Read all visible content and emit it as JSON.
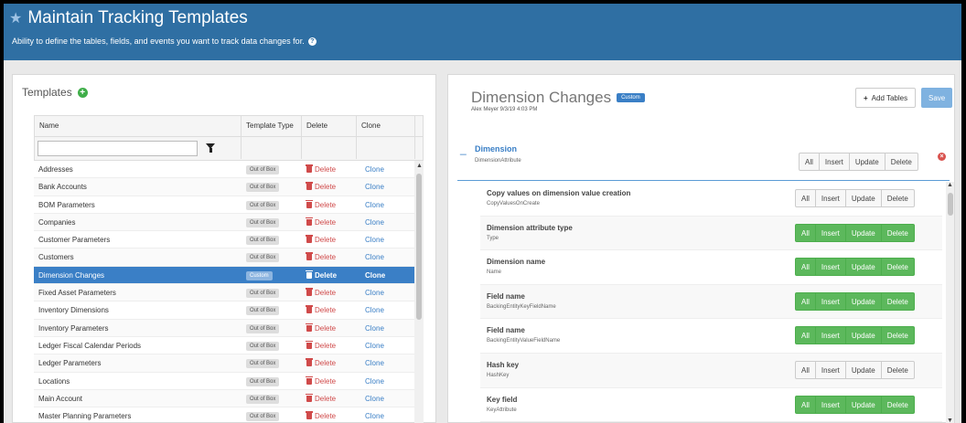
{
  "header": {
    "title": "Maintain Tracking Templates",
    "subtitle": "Ability to define the tables, fields, and events you want to track data changes for."
  },
  "templates_panel": {
    "heading": "Templates",
    "columns": [
      "Name",
      "Template Type",
      "Delete",
      "Clone"
    ],
    "filter_value": "",
    "rows": [
      {
        "name": "Addresses",
        "type": "Out of Box",
        "delete": "Delete",
        "clone": "Clone",
        "selected": false
      },
      {
        "name": "Bank Accounts",
        "type": "Out of Box",
        "delete": "Delete",
        "clone": "Clone",
        "selected": false
      },
      {
        "name": "BOM Parameters",
        "type": "Out of Box",
        "delete": "Delete",
        "clone": "Clone",
        "selected": false
      },
      {
        "name": "Companies",
        "type": "Out of Box",
        "delete": "Delete",
        "clone": "Clone",
        "selected": false
      },
      {
        "name": "Customer Parameters",
        "type": "Out of Box",
        "delete": "Delete",
        "clone": "Clone",
        "selected": false
      },
      {
        "name": "Customers",
        "type": "Out of Box",
        "delete": "Delete",
        "clone": "Clone",
        "selected": false
      },
      {
        "name": "Dimension Changes",
        "type": "Custom",
        "delete": "Delete",
        "clone": "Clone",
        "selected": true
      },
      {
        "name": "Fixed Asset Parameters",
        "type": "Out of Box",
        "delete": "Delete",
        "clone": "Clone",
        "selected": false
      },
      {
        "name": "Inventory Dimensions",
        "type": "Out of Box",
        "delete": "Delete",
        "clone": "Clone",
        "selected": false
      },
      {
        "name": "Inventory Parameters",
        "type": "Out of Box",
        "delete": "Delete",
        "clone": "Clone",
        "selected": false
      },
      {
        "name": "Ledger Fiscal Calendar Periods",
        "type": "Out of Box",
        "delete": "Delete",
        "clone": "Clone",
        "selected": false
      },
      {
        "name": "Ledger Parameters",
        "type": "Out of Box",
        "delete": "Delete",
        "clone": "Clone",
        "selected": false
      },
      {
        "name": "Locations",
        "type": "Out of Box",
        "delete": "Delete",
        "clone": "Clone",
        "selected": false
      },
      {
        "name": "Main Account",
        "type": "Out of Box",
        "delete": "Delete",
        "clone": "Clone",
        "selected": false
      },
      {
        "name": "Master Planning Parameters",
        "type": "Out of Box",
        "delete": "Delete",
        "clone": "Clone",
        "selected": false
      }
    ]
  },
  "detail_panel": {
    "title": "Dimension Changes",
    "badge": "Custom",
    "meta": "Alex Meyer  9/3/19 4:03 PM",
    "add_tables_label": "Add Tables",
    "save_label": "Save",
    "event_labels": [
      "All",
      "Insert",
      "Update",
      "Delete"
    ],
    "table": {
      "toggle": "_",
      "name": "Dimension",
      "entity": "DimensionAttribute",
      "active": false
    },
    "fields": [
      {
        "label": "Copy values on dimension value creation",
        "field": "CopyValuesOnCreate",
        "active": false
      },
      {
        "label": "Dimension attribute type",
        "field": "Type",
        "active": true
      },
      {
        "label": "Dimension name",
        "field": "Name",
        "active": true
      },
      {
        "label": "Field name",
        "field": "BackingEntityKeyFieldName",
        "active": true
      },
      {
        "label": "Field name",
        "field": "BackingEntityValueFieldName",
        "active": true
      },
      {
        "label": "Hash key",
        "field": "HashKey",
        "active": false
      },
      {
        "label": "Key field",
        "field": "KeyAttribute",
        "active": true
      }
    ]
  },
  "colors": {
    "header_bg": "#2f6fa3",
    "selected_row": "#3a7fc6",
    "active_event": "#5cb85c",
    "delete_red": "#d04a4a"
  }
}
